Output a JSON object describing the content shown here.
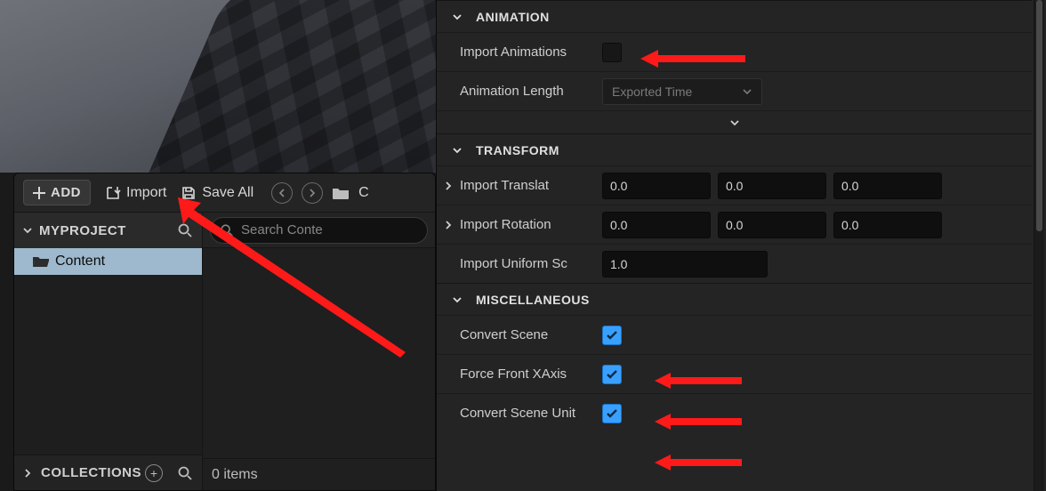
{
  "toolbar": {
    "add_label": "ADD",
    "import_label": "Import",
    "save_all_label": "Save All",
    "breadcrumb_initial": "C"
  },
  "tree": {
    "project_label": "MYPROJECT",
    "root_item": "Content",
    "collections_label": "COLLECTIONS"
  },
  "list": {
    "search_placeholder": "Search Conte",
    "status": "0 items"
  },
  "sections": {
    "animation": {
      "header": "ANIMATION",
      "import_animations": "Import Animations",
      "animation_length": "Animation Length",
      "animation_length_value": "Exported Time",
      "import_animations_checked": false
    },
    "transform": {
      "header": "TRANSFORM",
      "import_translation": "Import Translat",
      "translation": {
        "x": "0.0",
        "y": "0.0",
        "z": "0.0"
      },
      "import_rotation": "Import Rotation",
      "rotation": {
        "x": "0.0",
        "y": "0.0",
        "z": "0.0"
      },
      "import_uniform_scale": "Import Uniform Sc",
      "scale": "1.0"
    },
    "misc": {
      "header": "MISCELLANEOUS",
      "convert_scene": "Convert Scene",
      "convert_scene_checked": true,
      "force_front_xaxis": "Force Front XAxis",
      "force_front_xaxis_checked": true,
      "convert_scene_unit": "Convert Scene Unit",
      "convert_scene_unit_checked": true
    }
  }
}
